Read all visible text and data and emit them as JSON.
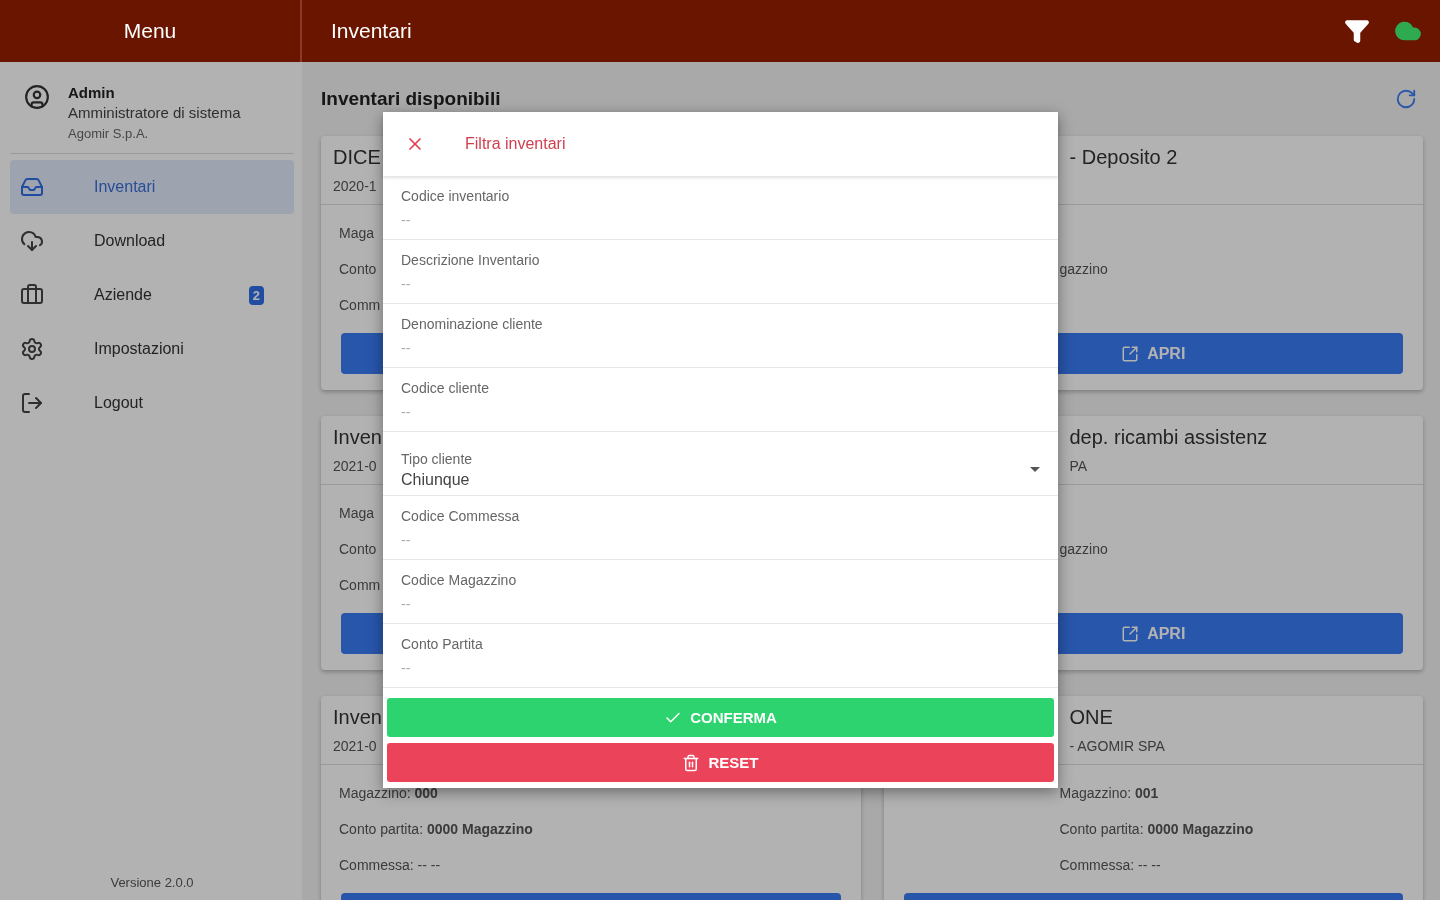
{
  "menu_header": {
    "title": "Menu"
  },
  "toolbar": {
    "title": "Inventari"
  },
  "profile": {
    "name": "Admin",
    "role": "Amministratore di sistema",
    "company": "Agomir S.p.A."
  },
  "sidebar": {
    "items": [
      {
        "kind": "inbox",
        "label": "Inventari",
        "selected": true
      },
      {
        "kind": "download",
        "label": "Download",
        "selected": false
      },
      {
        "kind": "briefcase",
        "label": "Aziende",
        "selected": false,
        "badge": "2"
      },
      {
        "kind": "settings",
        "label": "Impostazioni",
        "selected": false
      },
      {
        "kind": "logout",
        "label": "Logout",
        "selected": false
      }
    ],
    "version": "Versione 2.0.0"
  },
  "main": {
    "title": "Inventari disponibili",
    "cards": [
      {
        "title": "DICE",
        "subtitle": "2020-1",
        "lines": [
          "Maga",
          "Conto",
          "Comm"
        ],
        "button": {
          "kind": "bar"
        }
      },
      {
        "title": "- Deposito 2",
        "lines": [
          "gazzino"
        ],
        "button": {
          "kind": "open",
          "label": "APRI"
        }
      },
      {
        "title": "Inven",
        "subtitle": "2021-0",
        "lines": [
          "Maga",
          "Conto",
          "Comm"
        ],
        "button": {
          "kind": "bar"
        }
      },
      {
        "title": "dep. ricambi assistenz",
        "subtitle": "PA",
        "lines": [
          "gazzino"
        ],
        "button": {
          "kind": "open",
          "label": "APRI"
        }
      },
      {
        "title": "Inven",
        "subtitle": "2021-0",
        "lines": [
          "Magazzino: **000**",
          "Conto partita: **0000 Magazzino**",
          "Commessa: -- --"
        ],
        "button": {
          "kind": "bar"
        }
      },
      {
        "title": "ONE",
        "subtitle": "- AGOMIR SPA",
        "lines": [
          "Magazzino: **001**",
          "Conto partita: **0000 Magazzino**",
          "Commessa: -- --"
        ],
        "button": {
          "kind": "bar"
        }
      }
    ]
  },
  "dialog": {
    "title": "Filtra inventari",
    "fields": [
      {
        "kind": "text",
        "label": "Codice inventario",
        "placeholder": "--"
      },
      {
        "kind": "text",
        "label": "Descrizione Inventario",
        "placeholder": "--"
      },
      {
        "kind": "text",
        "label": "Denominazione cliente",
        "placeholder": "--"
      },
      {
        "kind": "text",
        "label": "Codice cliente",
        "placeholder": "--"
      },
      {
        "kind": "select",
        "label": "Tipo cliente",
        "value": "Chiunque"
      },
      {
        "kind": "text",
        "label": "Codice Commessa",
        "placeholder": "--"
      },
      {
        "kind": "text",
        "label": "Codice Magazzino",
        "placeholder": "--"
      },
      {
        "kind": "text",
        "label": "Conto Partita",
        "placeholder": "--"
      }
    ],
    "confirm": "CONFERMA",
    "reset": "RESET"
  }
}
